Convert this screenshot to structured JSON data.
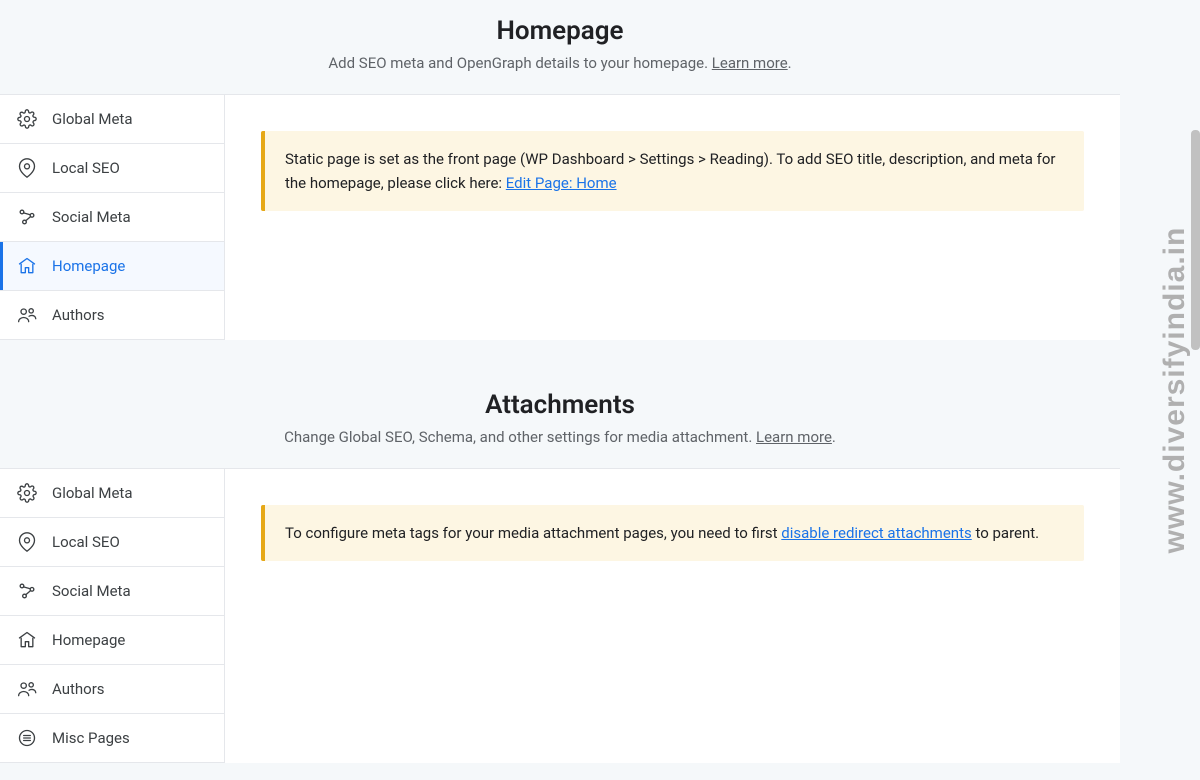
{
  "watermark": "www.diversifyindia.in",
  "section1": {
    "title": "Homepage",
    "subtitle_prefix": "Add SEO meta and OpenGraph details to your homepage. ",
    "subtitle_link": "Learn more",
    "subtitle_suffix": ".",
    "notice_prefix": "Static page is set as the front page (WP Dashboard > Settings > Reading). To add SEO title, description, and meta for the homepage, please click here: ",
    "notice_link": "Edit Page: Home",
    "sidebar": [
      {
        "label": "Global Meta",
        "icon": "gear"
      },
      {
        "label": "Local SEO",
        "icon": "pin"
      },
      {
        "label": "Social Meta",
        "icon": "share"
      },
      {
        "label": "Homepage",
        "icon": "home",
        "active": true
      },
      {
        "label": "Authors",
        "icon": "users"
      }
    ]
  },
  "section2": {
    "title": "Attachments",
    "subtitle_prefix": "Change Global SEO, Schema, and other settings for media attachment. ",
    "subtitle_link": "Learn more",
    "subtitle_suffix": ".",
    "notice_prefix": "To configure meta tags for your media attachment pages, you need to first ",
    "notice_link": "disable redirect attachments",
    "notice_suffix": " to parent.",
    "sidebar": [
      {
        "label": "Global Meta",
        "icon": "gear"
      },
      {
        "label": "Local SEO",
        "icon": "pin"
      },
      {
        "label": "Social Meta",
        "icon": "share"
      },
      {
        "label": "Homepage",
        "icon": "home"
      },
      {
        "label": "Authors",
        "icon": "users"
      },
      {
        "label": "Misc Pages",
        "icon": "list"
      }
    ]
  }
}
